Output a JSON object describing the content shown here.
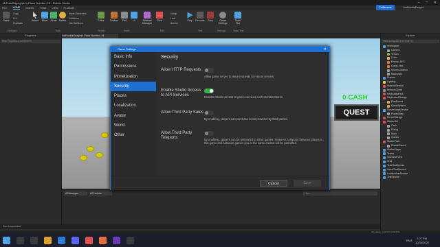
{
  "window": {
    "title": "MrPolleEdgreyNav's Place Number: 16 - Roblox Studio",
    "controls": [
      "–",
      "□",
      "✕"
    ]
  },
  "menubar": {
    "tabs": [
      "FILE",
      "HOME",
      "MODEL",
      "TEST",
      "VIEW",
      "PLUGINS"
    ],
    "active": "HOME",
    "collaborate": "Collaborate",
    "user": "JosiNoubleDeaylet"
  },
  "ribbon": {
    "tools": [
      {
        "label": "Paste",
        "icon": "paste-icon"
      },
      {
        "label": "Select",
        "icon": "cursor-icon"
      },
      {
        "label": "Move",
        "icon": "move-icon"
      },
      {
        "label": "Scale",
        "icon": "scale-icon"
      },
      {
        "label": "Rotate",
        "icon": "rotate-icon"
      },
      {
        "label": "Editor",
        "icon": "terrain-editor-icon"
      },
      {
        "label": "Toolbox",
        "icon": "toolbox-icon"
      },
      {
        "label": "Part",
        "icon": "part-icon"
      },
      {
        "label": "UI",
        "icon": "ui-icon"
      },
      {
        "label": "Material Manager",
        "icon": "material-manager-icon"
      },
      {
        "label": "Color",
        "icon": "color-icon"
      },
      {
        "label": "Play",
        "icon": "play-icon"
      },
      {
        "label": "Resume",
        "icon": "resume-icon"
      },
      {
        "label": "Stop",
        "icon": "stop-icon"
      },
      {
        "label": "Game Settings",
        "icon": "game-settings-icon"
      },
      {
        "label": "Team Test",
        "icon": "team-test-icon"
      }
    ],
    "small_items": [
      "Copy",
      "Cut",
      "Duplicate",
      "Mode:",
      "Geometric",
      "Collisions",
      "Join Surfaces",
      "Group",
      "Lock",
      "Anchor"
    ],
    "groups": [
      "Clipboard",
      "Tools",
      "Terrain",
      "Insert",
      "Edit",
      "Test",
      "Settings",
      "Team Test"
    ]
  },
  "document_tab": "JosiNoubleDeaylet's Place Number: 16",
  "properties_panel": {
    "title": "Properties",
    "filter_placeholder": "Filter Properties (Ctrl+Shift+P)"
  },
  "viewport": {
    "cash_text": "0 CASH",
    "quest_text": "QUEST",
    "cash_color": "#2cd12c"
  },
  "output_panel": {
    "messages_filter": "All Messages",
    "contexts_filter": "All Contexts",
    "search_placeholder": "Filter..."
  },
  "command_bar": {
    "placeholder": "Run a command"
  },
  "explorer": {
    "title": "Explorer",
    "filter_placeholder": "Filter workspace (Ctrl+Shift+X)",
    "items": [
      {
        "label": "Workspace",
        "level": 0,
        "color": "#4fa3e0"
      },
      {
        "label": "Camera",
        "level": 1,
        "color": "#a0a0a0"
      },
      {
        "label": "Terrain",
        "level": 1,
        "color": "#7cb342"
      },
      {
        "label": "Coins",
        "level": 1,
        "color": "#e0c040"
      },
      {
        "label": "Enemy_NPC",
        "level": 1,
        "color": "#e07040"
      },
      {
        "label": "Quest_Npc",
        "level": 1,
        "color": "#e07040"
      },
      {
        "label": "SpawnLocation",
        "level": 1,
        "color": "#9e9e9e"
      },
      {
        "label": "Baseplate",
        "level": 1,
        "color": "#9e9e9e"
      },
      {
        "label": "Players",
        "level": 0,
        "color": "#4fa3e0"
      },
      {
        "label": "Lighting",
        "level": 0,
        "color": "#f2c94c"
      },
      {
        "label": "MaterialService",
        "level": 0,
        "color": "#d85050"
      },
      {
        "label": "NetworkClient",
        "level": 0,
        "color": "#8c8c8c"
      },
      {
        "label": "ReplicatedFirst",
        "level": 0,
        "color": "#d85050"
      },
      {
        "label": "ReplicatedStorage",
        "level": 0,
        "color": "#d85050"
      },
      {
        "label": "PlayRound",
        "level": 1,
        "color": "#d8a040"
      },
      {
        "label": "QuestSystem",
        "level": 1,
        "color": "#d8a040"
      },
      {
        "label": "ServerScriptService",
        "level": 0,
        "color": "#4fa3e0"
      },
      {
        "label": "PlayerStats",
        "level": 1,
        "color": "#a0a0a0"
      },
      {
        "label": "ServerStorage",
        "level": 0,
        "color": "#d85050"
      },
      {
        "label": "StarterGui",
        "level": 0,
        "color": "#d85050"
      },
      {
        "label": "Cash",
        "level": 1,
        "color": "#a0a0a0"
      },
      {
        "label": "Dialog",
        "level": 1,
        "color": "#a0a0a0"
      },
      {
        "label": "Main",
        "level": 1,
        "color": "#a0a0a0"
      },
      {
        "label": "Quests",
        "level": 1,
        "color": "#a0a0a0"
      },
      {
        "label": "StarterPack",
        "level": 0,
        "color": "#d85050"
      },
      {
        "label": "ClassicSword",
        "level": 1,
        "color": "#a0a0a0"
      },
      {
        "label": "StarterPlayer",
        "level": 0,
        "color": "#4fa3e0"
      },
      {
        "label": "Teams",
        "level": 0,
        "color": "#4fa3e0"
      },
      {
        "label": "SoundService",
        "level": 0,
        "color": "#4fa3e0"
      },
      {
        "label": "Chat",
        "level": 0,
        "color": "#4fa3e0"
      },
      {
        "label": "TextChatService",
        "level": 0,
        "color": "#4fa3e0"
      },
      {
        "label": "VoiceChatService",
        "level": 0,
        "color": "#4fa3e0"
      },
      {
        "label": "LocalizationService",
        "level": 0,
        "color": "#4fa3e0"
      },
      {
        "label": "TestService",
        "level": 0,
        "color": "#4fa3e0"
      }
    ]
  },
  "status_bar": {
    "left": "",
    "right": "Simulation: 0.00 FPS   0.00 FPS"
  },
  "taskbar": {
    "time": "7:07 PM",
    "date": "10/30/2022",
    "lang": "ENG"
  },
  "dialog": {
    "title": "Game Settings",
    "close": "✕",
    "nav": [
      "Basic Info",
      "Permissions",
      "Monetization",
      "Security",
      "Places",
      "Localization",
      "Avatar",
      "World",
      "Other"
    ],
    "active_nav": "Security",
    "section_title": "Security",
    "settings": [
      {
        "label": "Allow HTTP Requests",
        "on": false,
        "desc": "Allow game server to issue requests to remote servers."
      },
      {
        "label": "Enable Studio Access to API Services",
        "on": true,
        "desc": "Enables Studio access to game services such as Data Stores."
      },
      {
        "label": "Allow Third Party Sales",
        "on": false,
        "desc": "By enabling, players can purchase items provided by third parties."
      },
      {
        "label": "Allow Third Party Teleports",
        "on": false,
        "desc": "By enabling, players can be teleported to other games. However, teleports between places in this game and between games you or the same creator will be permitted."
      }
    ],
    "cancel": "Cancel",
    "save": "Save",
    "accent": "#1f6fd1",
    "toggle_on_color": "#37b34a"
  }
}
